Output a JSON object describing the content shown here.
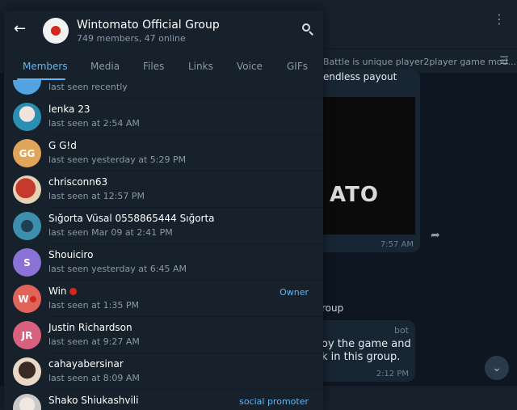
{
  "background": {
    "pinned_text": "Battle is unique player2player game mod...",
    "message_text": "endless payout",
    "image_text": "ATO",
    "image_time": "7:57 AM",
    "fragment_group": "roup",
    "bot_label": "bot",
    "bot_line1": "oy the game and",
    "bot_line2": "k in this group.",
    "bot_time": "2:12 PM"
  },
  "header": {
    "title": "Wintomato Official Group",
    "subtitle": "749 members, 47 online"
  },
  "tabs": [
    {
      "label": "Members",
      "active": true
    },
    {
      "label": "Media",
      "active": false
    },
    {
      "label": "Files",
      "active": false
    },
    {
      "label": "Links",
      "active": false
    },
    {
      "label": "Voice",
      "active": false
    },
    {
      "label": "GIFs",
      "active": false
    }
  ],
  "members": [
    {
      "name": "",
      "status": "last seen recently",
      "initials": "",
      "color": "#54a3e0",
      "role": ""
    },
    {
      "name": "lenka 23",
      "status": "last seen at 2:54 AM",
      "initials": "",
      "color": "#5fb7d6",
      "role": ""
    },
    {
      "name": "G G!d",
      "status": "last seen yesterday at 5:29 PM",
      "initials": "GG",
      "color": "#e0a55a",
      "role": ""
    },
    {
      "name": "chrisconn63",
      "status": "last seen at 12:57 PM",
      "initials": "",
      "color": "#b2382e",
      "role": ""
    },
    {
      "name": "Sığorta Vüsal 0558865444 Sığorta",
      "status": "last seen Mar 09 at 2:41 PM",
      "initials": "",
      "color": "#3d8fb0",
      "role": ""
    },
    {
      "name": "Shouiciro",
      "status": "last seen yesterday at 6:45 AM",
      "initials": "S",
      "color": "#8a72d6",
      "role": ""
    },
    {
      "name": "Win",
      "status": "last seen at 1:35 PM",
      "initials": "W",
      "color": "#e0645a",
      "role": "Owner"
    },
    {
      "name": "Justin Richardson",
      "status": "last seen at 9:27 AM",
      "initials": "JR",
      "color": "#d9607e",
      "role": ""
    },
    {
      "name": "cahayabersinar",
      "status": "last seen at 8:09 AM",
      "initials": "",
      "color": "#e9d8c6",
      "role": ""
    },
    {
      "name": "Shako Shiukashvili",
      "status": "",
      "initials": "",
      "color": "#c9c9c9",
      "role": "social promoter"
    }
  ],
  "colors": {
    "accent": "#5eb5f7",
    "panel": "#17212b",
    "chat_bg": "#0e1621"
  }
}
